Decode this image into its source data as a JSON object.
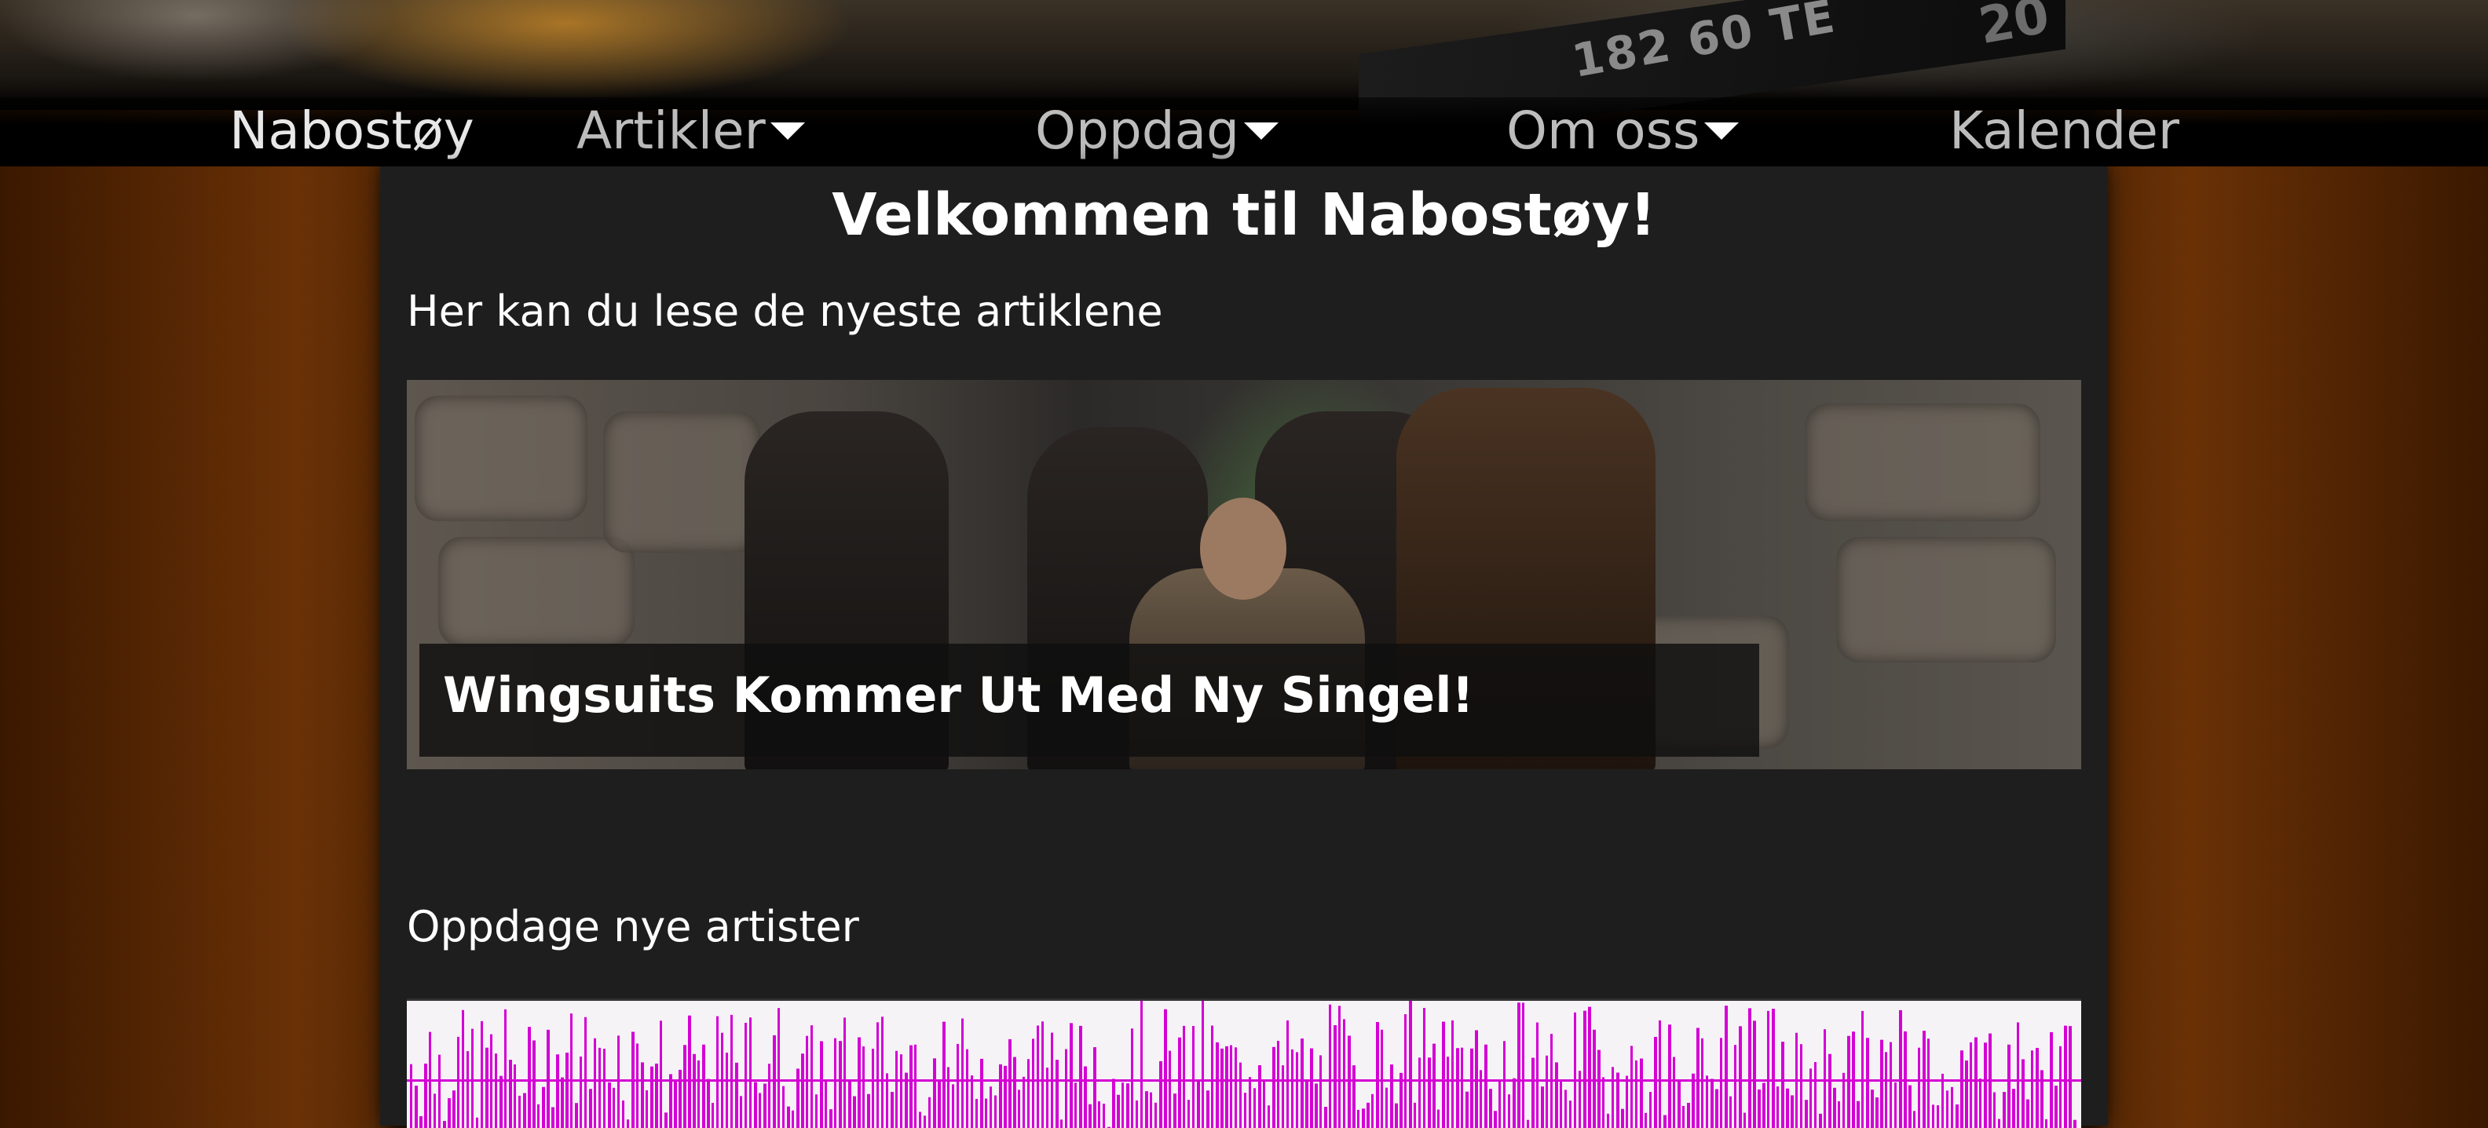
{
  "nav": {
    "brand": "Nabostøy",
    "items": [
      {
        "label": "Artikler",
        "has_dropdown": true
      },
      {
        "label": "Oppdag",
        "has_dropdown": true
      },
      {
        "label": "Om oss",
        "has_dropdown": true
      },
      {
        "label": "Kalender",
        "has_dropdown": false
      }
    ]
  },
  "banner": {
    "tape_text": "182 60 TE",
    "tape_text_right": "20"
  },
  "main": {
    "title": "Velkommen til Nabostøy!",
    "latest_heading": "Her kan du lese de nyeste artiklene",
    "featured_article": {
      "title": "Wingsuits Kommer Ut Med Ny Singel!"
    },
    "discover_heading": "Oppdage nye artister"
  },
  "colors": {
    "nav_text": "#bdbdbd",
    "panel_bg": "#1e1e1e",
    "waveform": "#d400d4",
    "accent_orange": "#6a3106"
  }
}
